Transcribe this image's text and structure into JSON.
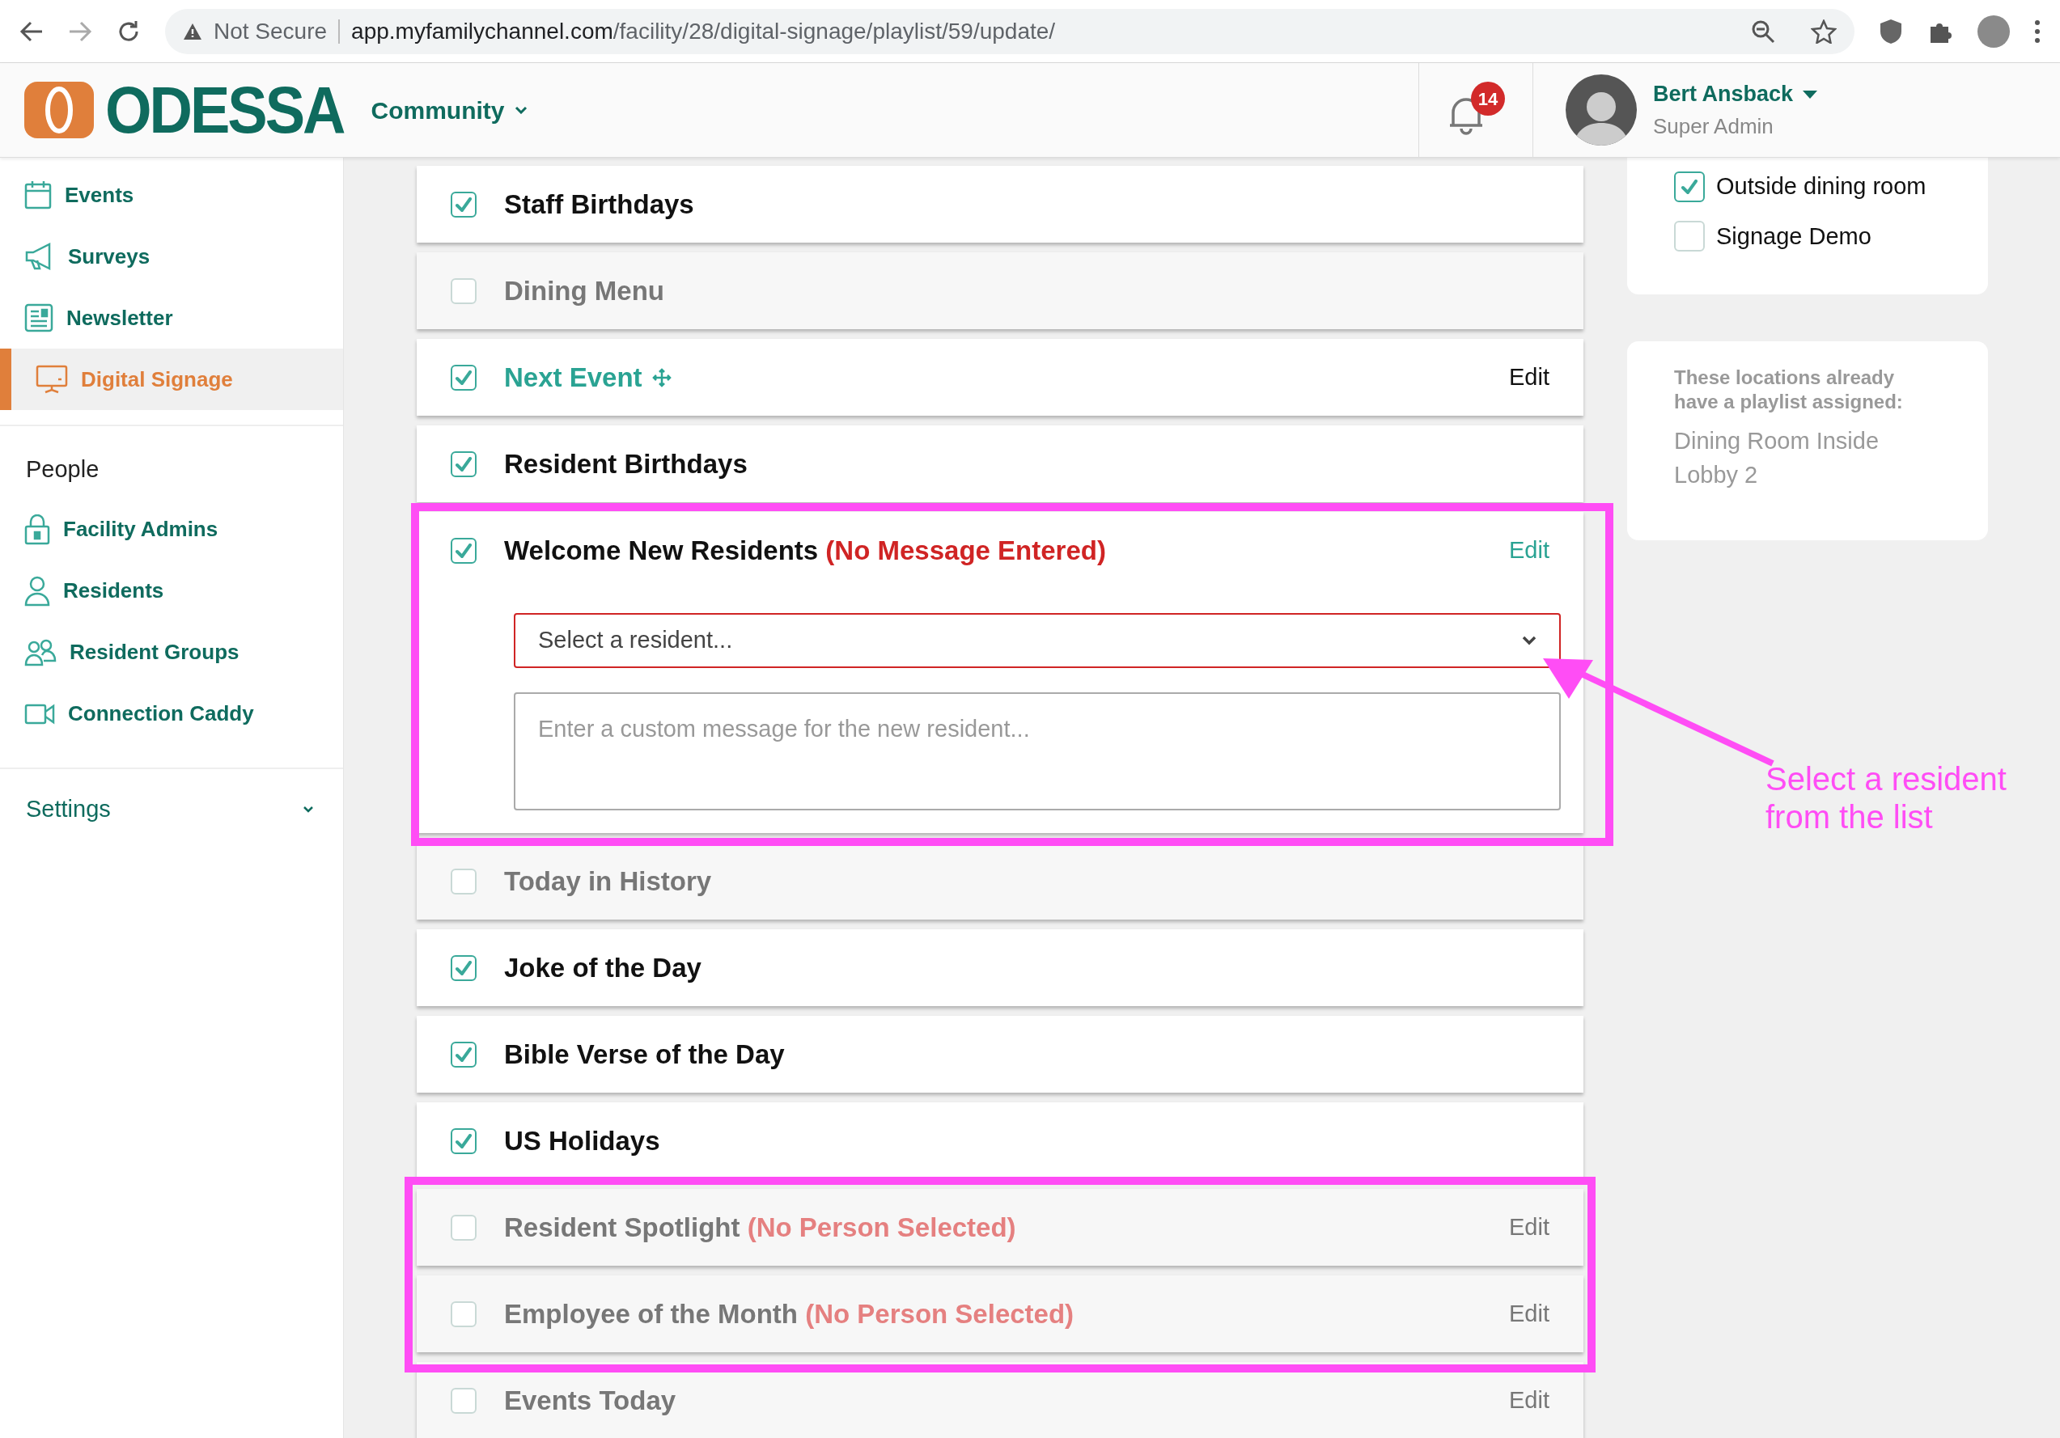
{
  "browser": {
    "security": "Not Secure",
    "url_host": "app.myfamilychannel.com",
    "url_path": "/facility/28/digital-signage/playlist/59/update/"
  },
  "header": {
    "logo": "ODESSA",
    "community": "Community",
    "notification_count": "14",
    "user_name": "Bert Ansback",
    "user_role": "Super Admin"
  },
  "sidebar": {
    "items": [
      {
        "label": "Events",
        "kind": "calendar",
        "selected": false
      },
      {
        "label": "Surveys",
        "kind": "megaphone",
        "selected": false
      },
      {
        "label": "Newsletter",
        "kind": "newspaper",
        "selected": false
      },
      {
        "label": "Digital Signage",
        "kind": "monitor",
        "selected": true
      }
    ],
    "section": "People",
    "people_items": [
      {
        "label": "Facility Admins",
        "kind": "lock",
        "selected": false
      },
      {
        "label": "Residents",
        "kind": "person",
        "selected": false
      },
      {
        "label": "Resident Groups",
        "kind": "people",
        "selected": false
      },
      {
        "label": "Connection Caddy",
        "kind": "video",
        "selected": false
      }
    ],
    "settings": "Settings"
  },
  "playlist": [
    {
      "title": "Staff Birthdays",
      "checked": true,
      "kind": "plain"
    },
    {
      "title": "Dining Menu",
      "checked": false,
      "kind": "plain"
    },
    {
      "title": "Next Event",
      "checked": true,
      "kind": "link",
      "edit": "Edit"
    },
    {
      "title": "Resident Birthdays",
      "checked": true,
      "kind": "plain"
    },
    {
      "title": "Welcome New Residents",
      "checked": true,
      "kind": "expanded",
      "warning": "(No Message Entered)",
      "edit": "Edit",
      "select_placeholder": "Select a resident...",
      "message_placeholder": "Enter a custom message for the new resident..."
    },
    {
      "title": "Today in History",
      "checked": false,
      "kind": "plain"
    },
    {
      "title": "Joke of the Day",
      "checked": true,
      "kind": "plain"
    },
    {
      "title": "Bible Verse of the Day",
      "checked": true,
      "kind": "plain"
    },
    {
      "title": "US Holidays",
      "checked": true,
      "kind": "plain"
    },
    {
      "title": "Resident Spotlight",
      "checked": false,
      "kind": "plain",
      "warning": "(No Person Selected)",
      "edit": "Edit"
    },
    {
      "title": "Employee of the Month",
      "checked": false,
      "kind": "plain",
      "warning": "(No Person Selected)",
      "edit": "Edit"
    },
    {
      "title": "Events Today",
      "checked": false,
      "kind": "plain",
      "edit": "Edit"
    }
  ],
  "locations": [
    {
      "label": "Outside dining room",
      "checked": true
    },
    {
      "label": "Signage Demo",
      "checked": false
    }
  ],
  "assigned": {
    "heading": "These locations already have a playlist assigned:",
    "items": [
      "Dining Room Inside",
      "Lobby 2"
    ]
  },
  "annotation": {
    "text": "Select a resident from the list"
  }
}
